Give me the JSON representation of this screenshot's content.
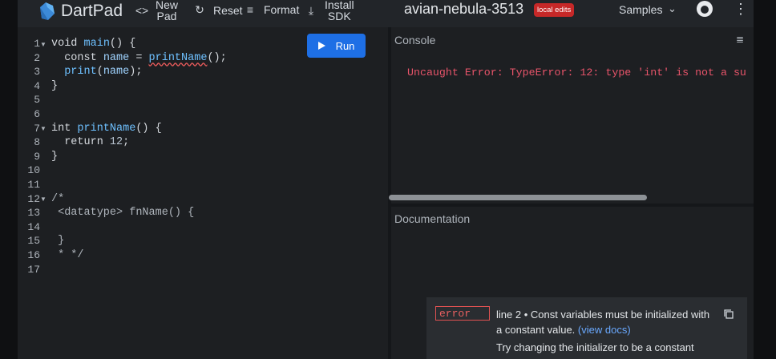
{
  "header": {
    "brand": "DartPad",
    "new_pad_line1": "New",
    "new_pad_line2": "Pad",
    "reset_label": "Reset",
    "format_label": "Format",
    "install_line1": "Install",
    "install_line2": "SDK",
    "pad_title": "avian-nebula-3513",
    "edit_badge": "local edits",
    "samples_label": "Samples"
  },
  "editor": {
    "run_label": "Run",
    "line_numbers": [
      "1",
      "2",
      "3",
      "4",
      "5",
      "6",
      "7",
      "8",
      "9",
      "10",
      "11",
      "12",
      "13",
      "14",
      "15",
      "16",
      "17"
    ],
    "code": {
      "l1_kw": "void ",
      "l1_fn": "main",
      "l1_rest": "() {",
      "l2_kw": "  const ",
      "l2_id": "name",
      "l2_eq": " = ",
      "l2_call": "printName",
      "l2_rest": "();",
      "l3_fn": "  print",
      "l3_open": "(",
      "l3_id": "name",
      "l3_rest": ");",
      "l4": "}",
      "l7_kw": "int ",
      "l7_fn": "printName",
      "l7_rest": "() {",
      "l8_kw": "  return ",
      "l8_num": "12",
      "l8_rest": ";",
      "l9": "}",
      "l12": "/*",
      "l13": " <datatype> fnName() {",
      "l15": " }",
      "l16": " * */"
    }
  },
  "console": {
    "title": "Console",
    "error_text": "Uncaught Error: TypeError: 12: type 'int' is not a su"
  },
  "documentation": {
    "title": "Documentation",
    "issue_severity": "error",
    "issue_message": "line 2 • Const variables must be initialized with a constant value.",
    "issue_link": "(view docs)",
    "issue_fix": "Try changing the initializer to be a constant"
  },
  "colors": {
    "accent": "#1e6fe5",
    "error": "#e8546a",
    "badge": "#c62828"
  }
}
